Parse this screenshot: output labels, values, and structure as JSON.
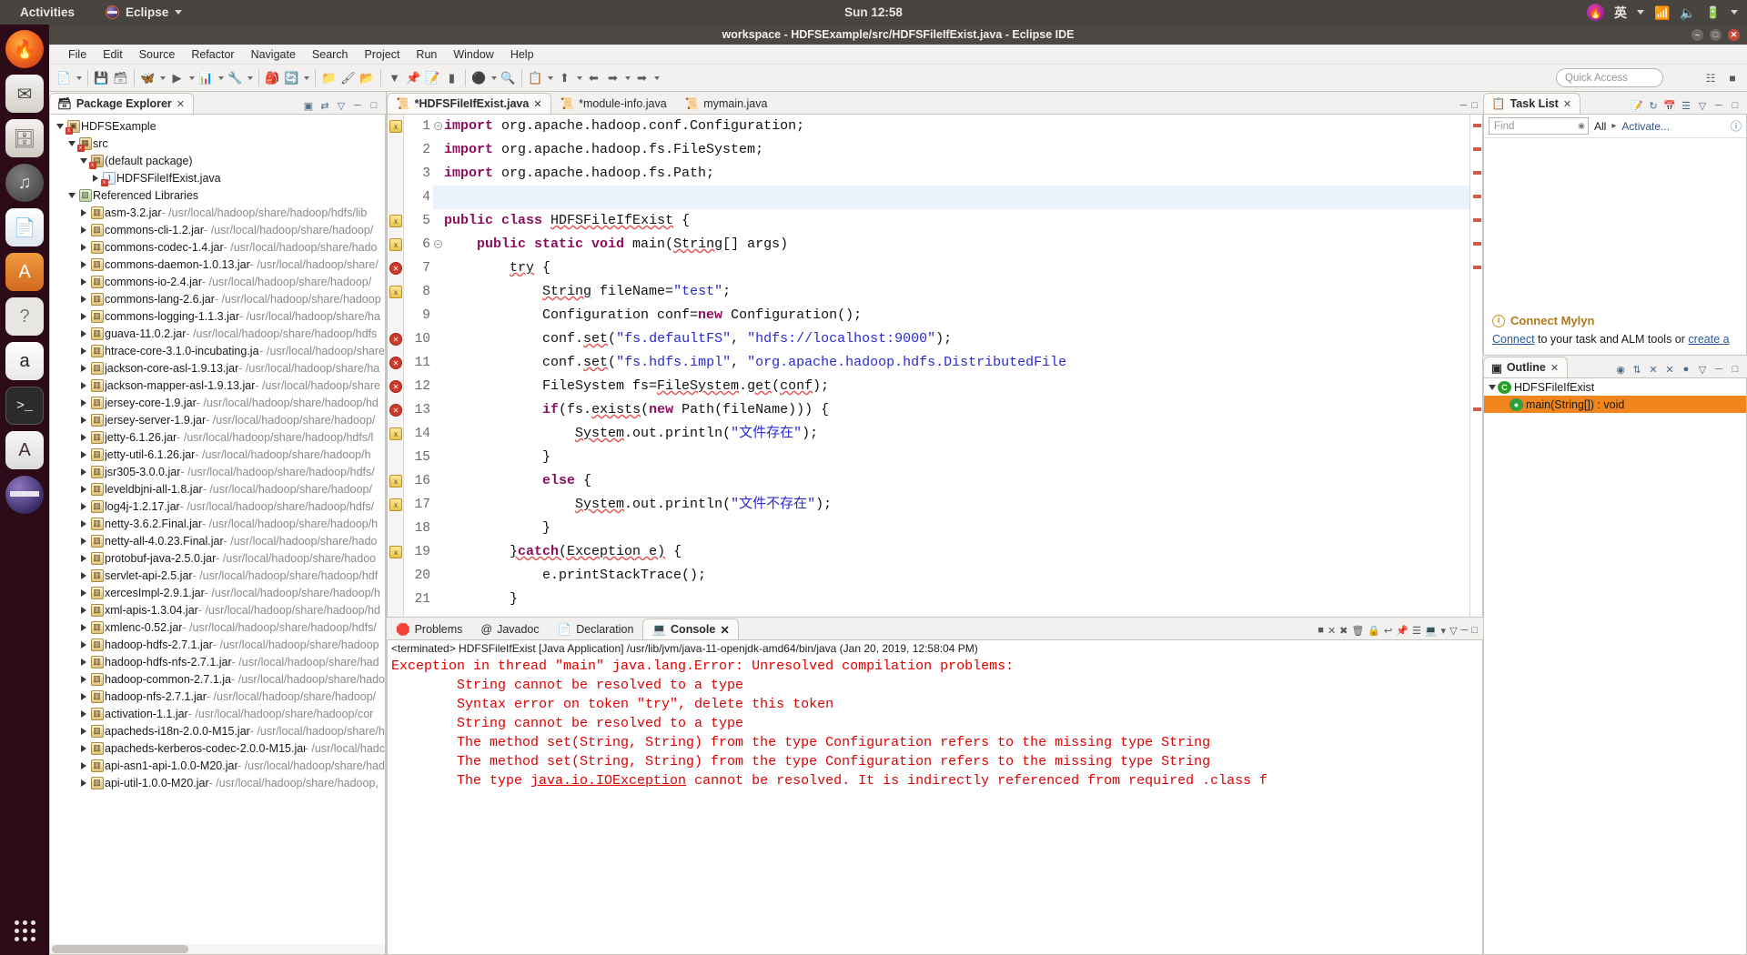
{
  "gnome": {
    "activities": "Activities",
    "app_name": "Eclipse",
    "clock": "Sun 12:58",
    "tray": {
      "flame_icon": "flame-icon",
      "ime": "英",
      "wifi_icon": "wifi-icon",
      "volume_icon": "volume-muted-icon",
      "battery_icon": "battery-charging-icon",
      "menu_icon": "chevron-down-icon"
    }
  },
  "dock": {
    "items": [
      {
        "name": "firefox",
        "glyph": "🔥"
      },
      {
        "name": "thunderbird-mail",
        "glyph": "✉"
      },
      {
        "name": "files",
        "glyph": "🗀"
      },
      {
        "name": "rhythmbox",
        "glyph": "♪"
      },
      {
        "name": "libreoffice-writer",
        "glyph": "📄"
      },
      {
        "name": "ubuntu-software",
        "glyph": "A"
      },
      {
        "name": "help",
        "glyph": "?"
      },
      {
        "name": "amazon",
        "glyph": "a"
      },
      {
        "name": "terminal",
        "glyph": ">_"
      },
      {
        "name": "software-updater",
        "glyph": "A"
      },
      {
        "name": "eclipse",
        "glyph": ""
      }
    ],
    "show_apps": "show-applications"
  },
  "window": {
    "title": "workspace - HDFSExample/src/HDFSFileIfExist.java - Eclipse IDE",
    "buttons": {
      "minimize": "–",
      "maximize": "□",
      "close": "✕"
    }
  },
  "menubar": [
    "File",
    "Edit",
    "Source",
    "Refactor",
    "Navigate",
    "Search",
    "Project",
    "Run",
    "Window",
    "Help"
  ],
  "toolbar": {
    "quick_access_placeholder": "Quick Access",
    "icons": [
      "new-wizard-icon",
      "save-icon",
      "save-all-icon",
      "debug-icon",
      "run-icon",
      "coverage-icon",
      "external-tools-icon",
      "new-java-project-icon",
      "new-package-icon",
      "open-type-icon",
      "search-icon",
      "last-edit-icon",
      "back-icon",
      "forward-icon"
    ],
    "perspective_icons": [
      "open-perspective-icon",
      "java-perspective-icon"
    ]
  },
  "package_explorer": {
    "tab_label": "Package Explorer",
    "tab_close": "✕",
    "tools": [
      "collapse-all-icon",
      "link-with-editor-icon",
      "view-menu-icon",
      "minimize-icon",
      "maximize-icon"
    ],
    "tree": [
      {
        "depth": 0,
        "twisty": "open",
        "icon": "project",
        "label": "HDFSExample",
        "path": "",
        "error": true
      },
      {
        "depth": 1,
        "twisty": "open",
        "icon": "src",
        "label": "src",
        "path": "",
        "error": true
      },
      {
        "depth": 2,
        "twisty": "open",
        "icon": "pkg",
        "label": "(default package)",
        "path": "",
        "error": true
      },
      {
        "depth": 3,
        "twisty": "closed",
        "icon": "java",
        "label": "HDFSFileIfExist.java",
        "path": "",
        "error": true
      },
      {
        "depth": 1,
        "twisty": "open",
        "icon": "lib",
        "label": "Referenced Libraries",
        "path": "",
        "error": false
      },
      {
        "depth": 2,
        "twisty": "closed",
        "icon": "jar",
        "label": "asm-3.2.jar",
        "path": " - /usr/local/hadoop/share/hadoop/hdfs/lib"
      },
      {
        "depth": 2,
        "twisty": "closed",
        "icon": "jar",
        "label": "commons-cli-1.2.jar",
        "path": " - /usr/local/hadoop/share/hadoop/"
      },
      {
        "depth": 2,
        "twisty": "closed",
        "icon": "jar",
        "label": "commons-codec-1.4.jar",
        "path": " - /usr/local/hadoop/share/hado"
      },
      {
        "depth": 2,
        "twisty": "closed",
        "icon": "jar",
        "label": "commons-daemon-1.0.13.jar",
        "path": " - /usr/local/hadoop/share/"
      },
      {
        "depth": 2,
        "twisty": "closed",
        "icon": "jar",
        "label": "commons-io-2.4.jar",
        "path": " - /usr/local/hadoop/share/hadoop/"
      },
      {
        "depth": 2,
        "twisty": "closed",
        "icon": "jar",
        "label": "commons-lang-2.6.jar",
        "path": " - /usr/local/hadoop/share/hadoop"
      },
      {
        "depth": 2,
        "twisty": "closed",
        "icon": "jar",
        "label": "commons-logging-1.1.3.jar",
        "path": " - /usr/local/hadoop/share/ha"
      },
      {
        "depth": 2,
        "twisty": "closed",
        "icon": "jar",
        "label": "guava-11.0.2.jar",
        "path": " - /usr/local/hadoop/share/hadoop/hdfs"
      },
      {
        "depth": 2,
        "twisty": "closed",
        "icon": "jar",
        "label": "htrace-core-3.1.0-incubating.jar",
        "path": " - /usr/local/hadoop/share"
      },
      {
        "depth": 2,
        "twisty": "closed",
        "icon": "jar",
        "label": "jackson-core-asl-1.9.13.jar",
        "path": " - /usr/local/hadoop/share/ha"
      },
      {
        "depth": 2,
        "twisty": "closed",
        "icon": "jar",
        "label": "jackson-mapper-asl-1.9.13.jar",
        "path": " - /usr/local/hadoop/share"
      },
      {
        "depth": 2,
        "twisty": "closed",
        "icon": "jar",
        "label": "jersey-core-1.9.jar",
        "path": " - /usr/local/hadoop/share/hadoop/hd"
      },
      {
        "depth": 2,
        "twisty": "closed",
        "icon": "jar",
        "label": "jersey-server-1.9.jar",
        "path": " - /usr/local/hadoop/share/hadoop/"
      },
      {
        "depth": 2,
        "twisty": "closed",
        "icon": "jar",
        "label": "jetty-6.1.26.jar",
        "path": " - /usr/local/hadoop/share/hadoop/hdfs/l"
      },
      {
        "depth": 2,
        "twisty": "closed",
        "icon": "jar",
        "label": "jetty-util-6.1.26.jar",
        "path": " - /usr/local/hadoop/share/hadoop/h"
      },
      {
        "depth": 2,
        "twisty": "closed",
        "icon": "jar",
        "label": "jsr305-3.0.0.jar",
        "path": " - /usr/local/hadoop/share/hadoop/hdfs/"
      },
      {
        "depth": 2,
        "twisty": "closed",
        "icon": "jar",
        "label": "leveldbjni-all-1.8.jar",
        "path": " - /usr/local/hadoop/share/hadoop/"
      },
      {
        "depth": 2,
        "twisty": "closed",
        "icon": "jar",
        "label": "log4j-1.2.17.jar",
        "path": " - /usr/local/hadoop/share/hadoop/hdfs/"
      },
      {
        "depth": 2,
        "twisty": "closed",
        "icon": "jar",
        "label": "netty-3.6.2.Final.jar",
        "path": " - /usr/local/hadoop/share/hadoop/h"
      },
      {
        "depth": 2,
        "twisty": "closed",
        "icon": "jar",
        "label": "netty-all-4.0.23.Final.jar",
        "path": " - /usr/local/hadoop/share/hado"
      },
      {
        "depth": 2,
        "twisty": "closed",
        "icon": "jar",
        "label": "protobuf-java-2.5.0.jar",
        "path": " - /usr/local/hadoop/share/hadoo"
      },
      {
        "depth": 2,
        "twisty": "closed",
        "icon": "jar",
        "label": "servlet-api-2.5.jar",
        "path": " - /usr/local/hadoop/share/hadoop/hdf"
      },
      {
        "depth": 2,
        "twisty": "closed",
        "icon": "jar",
        "label": "xercesImpl-2.9.1.jar",
        "path": " - /usr/local/hadoop/share/hadoop/h"
      },
      {
        "depth": 2,
        "twisty": "closed",
        "icon": "jar",
        "label": "xml-apis-1.3.04.jar",
        "path": " - /usr/local/hadoop/share/hadoop/hd"
      },
      {
        "depth": 2,
        "twisty": "closed",
        "icon": "jar",
        "label": "xmlenc-0.52.jar",
        "path": " - /usr/local/hadoop/share/hadoop/hdfs/"
      },
      {
        "depth": 2,
        "twisty": "closed",
        "icon": "jar",
        "label": "hadoop-hdfs-2.7.1.jar",
        "path": " - /usr/local/hadoop/share/hadoop"
      },
      {
        "depth": 2,
        "twisty": "closed",
        "icon": "jar",
        "label": "hadoop-hdfs-nfs-2.7.1.jar",
        "path": " - /usr/local/hadoop/share/had"
      },
      {
        "depth": 2,
        "twisty": "closed",
        "icon": "jar",
        "label": "hadoop-common-2.7.1.jar",
        "path": " - /usr/local/hadoop/share/hado"
      },
      {
        "depth": 2,
        "twisty": "closed",
        "icon": "jar",
        "label": "hadoop-nfs-2.7.1.jar",
        "path": " - /usr/local/hadoop/share/hadoop/"
      },
      {
        "depth": 2,
        "twisty": "closed",
        "icon": "jar",
        "label": "activation-1.1.jar",
        "path": " - /usr/local/hadoop/share/hadoop/cor"
      },
      {
        "depth": 2,
        "twisty": "closed",
        "icon": "jar",
        "label": "apacheds-i18n-2.0.0-M15.jar",
        "path": " - /usr/local/hadoop/share/h"
      },
      {
        "depth": 2,
        "twisty": "closed",
        "icon": "jar",
        "label": "apacheds-kerberos-codec-2.0.0-M15.jar",
        "path": " - /usr/local/hadc"
      },
      {
        "depth": 2,
        "twisty": "closed",
        "icon": "jar",
        "label": "api-asn1-api-1.0.0-M20.jar",
        "path": " - /usr/local/hadoop/share/had"
      },
      {
        "depth": 2,
        "twisty": "closed",
        "icon": "jar",
        "label": "api-util-1.0.0-M20.jar",
        "path": " - /usr/local/hadoop/share/hadoop,"
      }
    ]
  },
  "editor": {
    "tabs": [
      {
        "label": "*HDFSFileIfExist.java",
        "active": true,
        "close": "✕"
      },
      {
        "label": "*module-info.java",
        "active": false,
        "close": ""
      },
      {
        "label": "mymain.java",
        "active": false,
        "close": ""
      }
    ],
    "lines": [
      {
        "n": 1,
        "marker": "warn",
        "fold": true,
        "ovr": true,
        "html": "<span class=\"kw\">import</span> org.apache.hadoop.conf.Configuration;"
      },
      {
        "n": 2,
        "marker": "",
        "fold": false,
        "ovr": true,
        "html": "<span class=\"kw\">import</span> org.apache.hadoop.fs.FileSystem;"
      },
      {
        "n": 3,
        "marker": "",
        "fold": false,
        "ovr": true,
        "html": "<span class=\"kw\">import</span> org.apache.hadoop.fs.Path;"
      },
      {
        "n": 4,
        "marker": "",
        "fold": false,
        "ovr": true,
        "html": "",
        "hl": true
      },
      {
        "n": 5,
        "marker": "warn",
        "fold": false,
        "ovr": true,
        "html": "<span class=\"kw\">public class</span> <span class=\"sq\">HDFSFileIfExist</span> {"
      },
      {
        "n": 6,
        "marker": "warn",
        "fold": true,
        "ovr": true,
        "html": "    <span class=\"kw\">public static void</span> main(<span class=\"sq\">String</span>[] args)"
      },
      {
        "n": 7,
        "marker": "err",
        "fold": false,
        "ovr": true,
        "html": "        <span class=\"sq\">try</span> {"
      },
      {
        "n": 8,
        "marker": "warn",
        "fold": false,
        "ovr": false,
        "html": "            <span class=\"sq\">String</span> fileName=<span class=\"str\">\"test\"</span>;"
      },
      {
        "n": 9,
        "marker": "",
        "fold": false,
        "ovr": false,
        "html": "            Configuration conf=<span class=\"kw\">new</span> Configuration();"
      },
      {
        "n": 10,
        "marker": "err",
        "fold": false,
        "ovr": false,
        "html": "            conf.<span class=\"sq\">set</span>(<span class=\"str\">\"fs.defaultFS\"</span>, <span class=\"str\">\"hdfs://localhost:9000\"</span>);"
      },
      {
        "n": 11,
        "marker": "err",
        "fold": false,
        "ovr": false,
        "html": "            conf.<span class=\"sq\">set</span>(<span class=\"str\">\"fs.hdfs.impl\"</span>, <span class=\"str\">\"org.apache.hadoop.hdfs.DistributedFile</span>"
      },
      {
        "n": 12,
        "marker": "err",
        "fold": false,
        "ovr": false,
        "html": "            FileSystem fs=<span class=\"sq\">FileSystem</span>.<span class=\"sq\">get</span>(<span class=\"sq\">conf</span>);"
      },
      {
        "n": 13,
        "marker": "err",
        "fold": false,
        "ovr": true,
        "html": "            <span class=\"kw\">if</span>(fs.<span class=\"sq\">exists</span>(<span class=\"kw\">new</span> Path(fileName))) {"
      },
      {
        "n": 14,
        "marker": "warn",
        "fold": false,
        "ovr": false,
        "html": "                <span class=\"sq\">System</span>.out.println(<span class=\"str\">\"文件存在\"</span>);"
      },
      {
        "n": 15,
        "marker": "",
        "fold": false,
        "ovr": false,
        "html": "            }"
      },
      {
        "n": 16,
        "marker": "warn",
        "fold": false,
        "ovr": false,
        "html": "            <span class=\"kw\">else</span> {"
      },
      {
        "n": 17,
        "marker": "warn",
        "fold": false,
        "ovr": false,
        "html": "                <span class=\"sq\">System</span>.out.println(<span class=\"str\">\"文件不存在\"</span>);"
      },
      {
        "n": 18,
        "marker": "",
        "fold": false,
        "ovr": false,
        "html": "            }"
      },
      {
        "n": 19,
        "marker": "warn",
        "fold": false,
        "ovr": false,
        "html": "        <span class=\"sq\">}</span><span class=\"kw sq\">catch</span><span class=\"sq\">(Exception e)</span> {"
      },
      {
        "n": 20,
        "marker": "",
        "fold": false,
        "ovr": false,
        "html": "            e.printStackTrace();"
      },
      {
        "n": 21,
        "marker": "",
        "fold": false,
        "ovr": false,
        "html": "        }"
      }
    ]
  },
  "console": {
    "tabs": [
      {
        "label": "Problems",
        "icon": "problems-icon",
        "active": false
      },
      {
        "label": "Javadoc",
        "icon": "javadoc-icon",
        "active": false
      },
      {
        "label": "Declaration",
        "icon": "declaration-icon",
        "active": false
      },
      {
        "label": "Console",
        "icon": "console-icon",
        "active": true,
        "close": "✕"
      }
    ],
    "terminated_line": "<terminated> HDFSFileIfExist [Java Application] /usr/lib/jvm/java-11-openjdk-amd64/bin/java (Jan 20, 2019, 12:58:04 PM)",
    "output": [
      "Exception in thread \"main\" java.lang.Error: Unresolved compilation problems:",
      "        String cannot be resolved to a type",
      "        Syntax error on token \"try\", delete this token",
      "        String cannot be resolved to a type",
      "        The method set(String, String) from the type Configuration refers to the missing type String",
      "        The method set(String, String) from the type Configuration refers to the missing type String",
      "        The type java.io.IOException cannot be resolved. It is indirectly referenced from required .class f"
    ],
    "error_color": "#e00000"
  },
  "task_list": {
    "tab_label": "Task List",
    "tab_close": "✕",
    "find_placeholder": "Find",
    "all_label": "All",
    "activate_label": "Activate...",
    "help_icon": "help-icon",
    "mylyn_title": "Connect Mylyn",
    "mylyn_text_1": "Connect",
    "mylyn_text_2": " to your task and ALM tools or ",
    "mylyn_text_3": "create a"
  },
  "outline": {
    "tab_label": "Outline",
    "tab_close": "✕",
    "items": [
      {
        "label": "HDFSFileIfExist",
        "kind": "class",
        "selected": false,
        "twisty": "open"
      },
      {
        "label": "main(String[]) : void",
        "kind": "method",
        "selected": true,
        "twisty": ""
      }
    ]
  }
}
